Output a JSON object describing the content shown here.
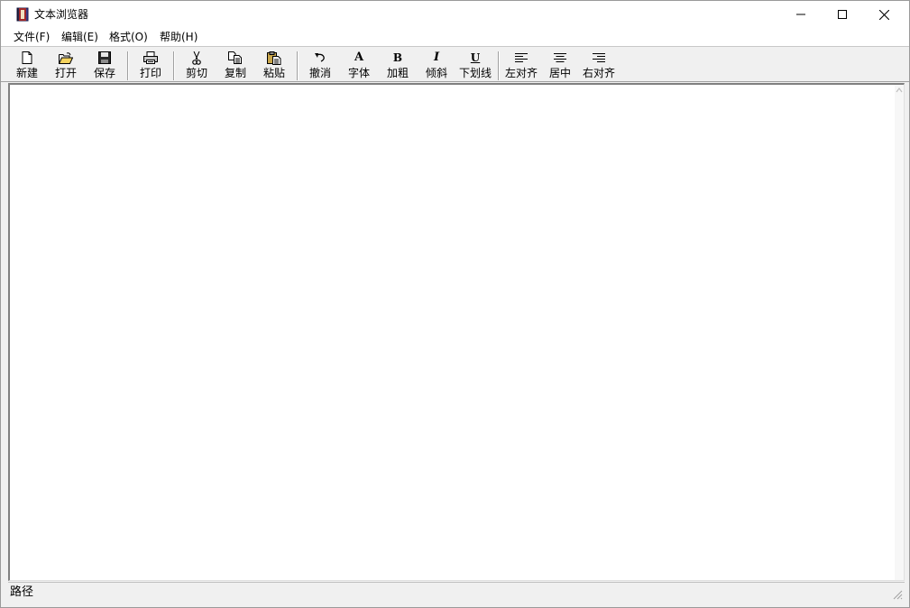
{
  "window": {
    "title": "文本浏览器",
    "icon": "book-icon"
  },
  "menu": {
    "items": [
      "文件(F)",
      "编辑(E)",
      "格式(O)",
      "帮助(H)"
    ]
  },
  "toolbar": {
    "buttons": [
      {
        "label": "新建",
        "icon": "new-file-icon"
      },
      {
        "label": "打开",
        "icon": "open-folder-icon"
      },
      {
        "label": "保存",
        "icon": "save-disk-icon"
      },
      {
        "label": "打印",
        "icon": "printer-icon"
      },
      {
        "label": "剪切",
        "icon": "scissors-icon"
      },
      {
        "label": "复制",
        "icon": "copy-icon"
      },
      {
        "label": "粘贴",
        "icon": "paste-icon"
      },
      {
        "label": "撤消",
        "icon": "undo-icon"
      },
      {
        "label": "字体",
        "icon": "font-icon",
        "glyph": "A"
      },
      {
        "label": "加粗",
        "icon": "bold-icon",
        "glyph": "B"
      },
      {
        "label": "倾斜",
        "icon": "italic-icon",
        "glyph": "I"
      },
      {
        "label": "下划线",
        "icon": "underline-icon",
        "glyph": "U"
      },
      {
        "label": "左对齐",
        "icon": "align-left-icon"
      },
      {
        "label": "居中",
        "icon": "align-center-icon"
      },
      {
        "label": "右对齐",
        "icon": "align-right-icon"
      }
    ]
  },
  "editor": {
    "content": ""
  },
  "status": {
    "path_label": "路径"
  }
}
